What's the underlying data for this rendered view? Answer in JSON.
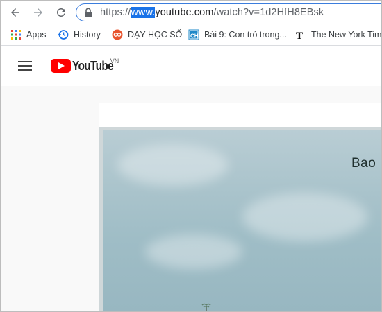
{
  "browser": {
    "url": {
      "prefix": "https://",
      "selected": "www.",
      "domain": "youtube.com",
      "path": "/watch?v=1d2HfH8EBsk"
    },
    "nav_icons": [
      "back-arrow-icon",
      "forward-arrow-icon",
      "reload-icon",
      "lock-icon"
    ]
  },
  "bookmarks": [
    {
      "label": "Apps",
      "icon": "apps-grid-icon"
    },
    {
      "label": "History",
      "icon": "history-icon"
    },
    {
      "label": "DẠY HỌC SỐ",
      "icon": "dayhocso-icon"
    },
    {
      "label": "Bài 9: Con trỏ trong...",
      "icon": "ch-site-icon"
    },
    {
      "label": "The New York Times",
      "icon": "nyt-icon"
    }
  ],
  "youtube": {
    "logo_text": "YouTube",
    "region": "VN"
  },
  "video": {
    "overlay_text": "Bao"
  },
  "colors": {
    "accent": "#1a73e8",
    "youtube_red": "#ff0000"
  }
}
